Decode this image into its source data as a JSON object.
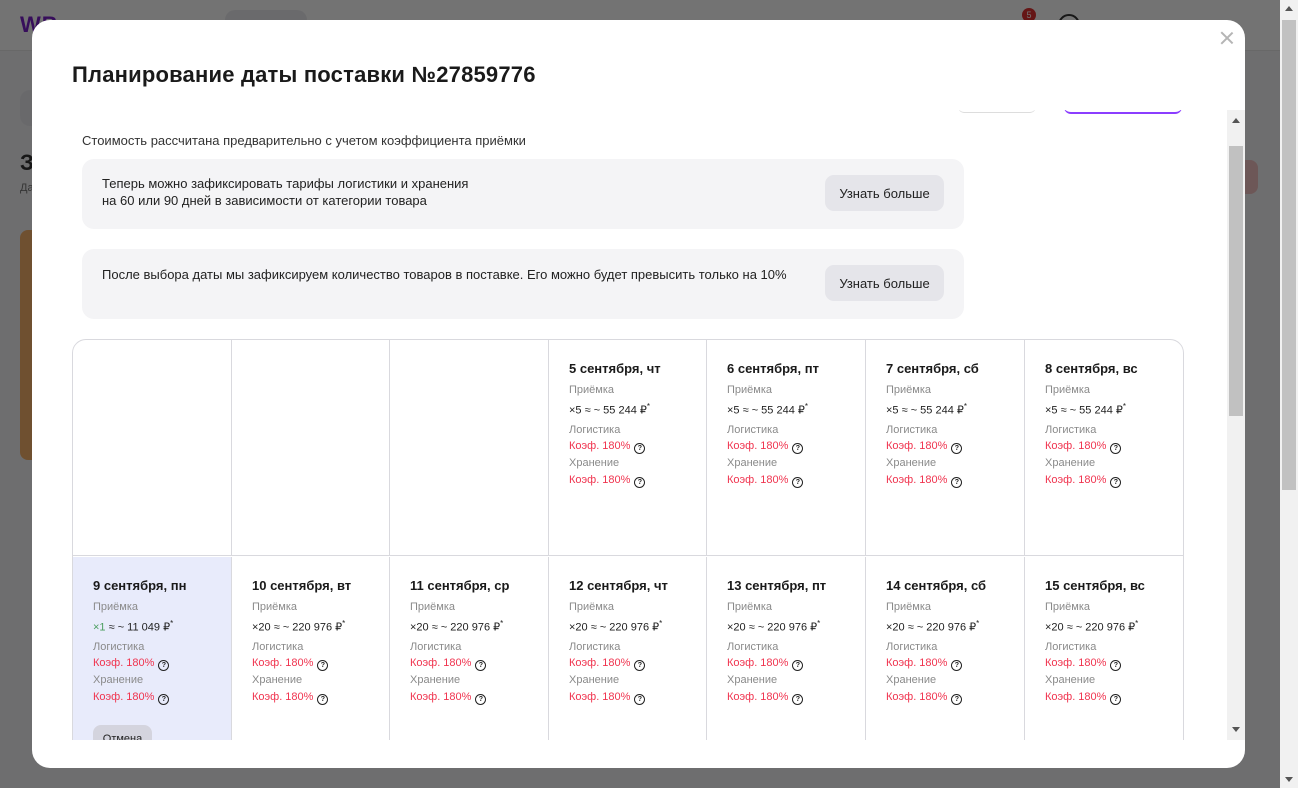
{
  "background": {
    "logo": "WB"
  },
  "modal": {
    "title": "Планирование даты поставки №27859776",
    "info_line": "Стоимость рассчитана предварительно с учетом коэффициента приёмки",
    "notes": [
      {
        "line1": "Теперь можно зафиксировать тарифы логистики и хранения",
        "line2": "на 60 или 90 дней в зависимости от категории товара",
        "button": "Узнать больше"
      },
      {
        "line1": "После выбора даты мы зафиксируем количество товаров в поставке. Его можно будет превысить только на 10%",
        "button": "Узнать больше"
      }
    ],
    "labels": {
      "acceptance": "Приёмка",
      "logistics": "Логистика",
      "storage": "Хранение",
      "coef": "Коэф. 180%",
      "help": "?"
    },
    "week1": [
      {
        "date": "5 сентября, чт",
        "mult": "×5",
        "cost": "≈ ~ 55 244 ₽",
        "star": "*"
      },
      {
        "date": "6 сентября, пт",
        "mult": "×5",
        "cost": "≈ ~ 55 244 ₽",
        "star": "*"
      },
      {
        "date": "7 сентября, сб",
        "mult": "×5",
        "cost": "≈ ~ 55 244 ₽",
        "star": "*"
      },
      {
        "date": "8 сентября, вс",
        "mult": "×5",
        "cost": "≈ ~ 55 244 ₽",
        "star": "*"
      }
    ],
    "week2": [
      {
        "date": "9 сентября, пн",
        "mult": "×1",
        "cost": "≈ ~ 11 049 ₽",
        "star": "*"
      },
      {
        "date": "10 сентября, вт",
        "mult": "×20",
        "cost": "≈ ~ 220 976 ₽",
        "star": "*"
      },
      {
        "date": "11 сентября, ср",
        "mult": "×20",
        "cost": "≈ ~ 220 976 ₽",
        "star": "*"
      },
      {
        "date": "12 сентября, чт",
        "mult": "×20",
        "cost": "≈ ~ 220 976 ₽",
        "star": "*"
      },
      {
        "date": "13 сентября, пт",
        "mult": "×20",
        "cost": "≈ ~ 220 976 ₽",
        "star": "*"
      },
      {
        "date": "14 сентября, сб",
        "mult": "×20",
        "cost": "≈ ~ 220 976 ₽",
        "star": "*"
      },
      {
        "date": "15 сентября, вс",
        "mult": "×20",
        "cost": "≈ ~ 220 976 ₽",
        "star": "*"
      }
    ],
    "cancel_label": "Отмена"
  },
  "colors": {
    "accent": "#8b3dff",
    "coef": "#f0344f",
    "selected_bg": "#e8ebfb",
    "green": "#4a9d5e"
  }
}
